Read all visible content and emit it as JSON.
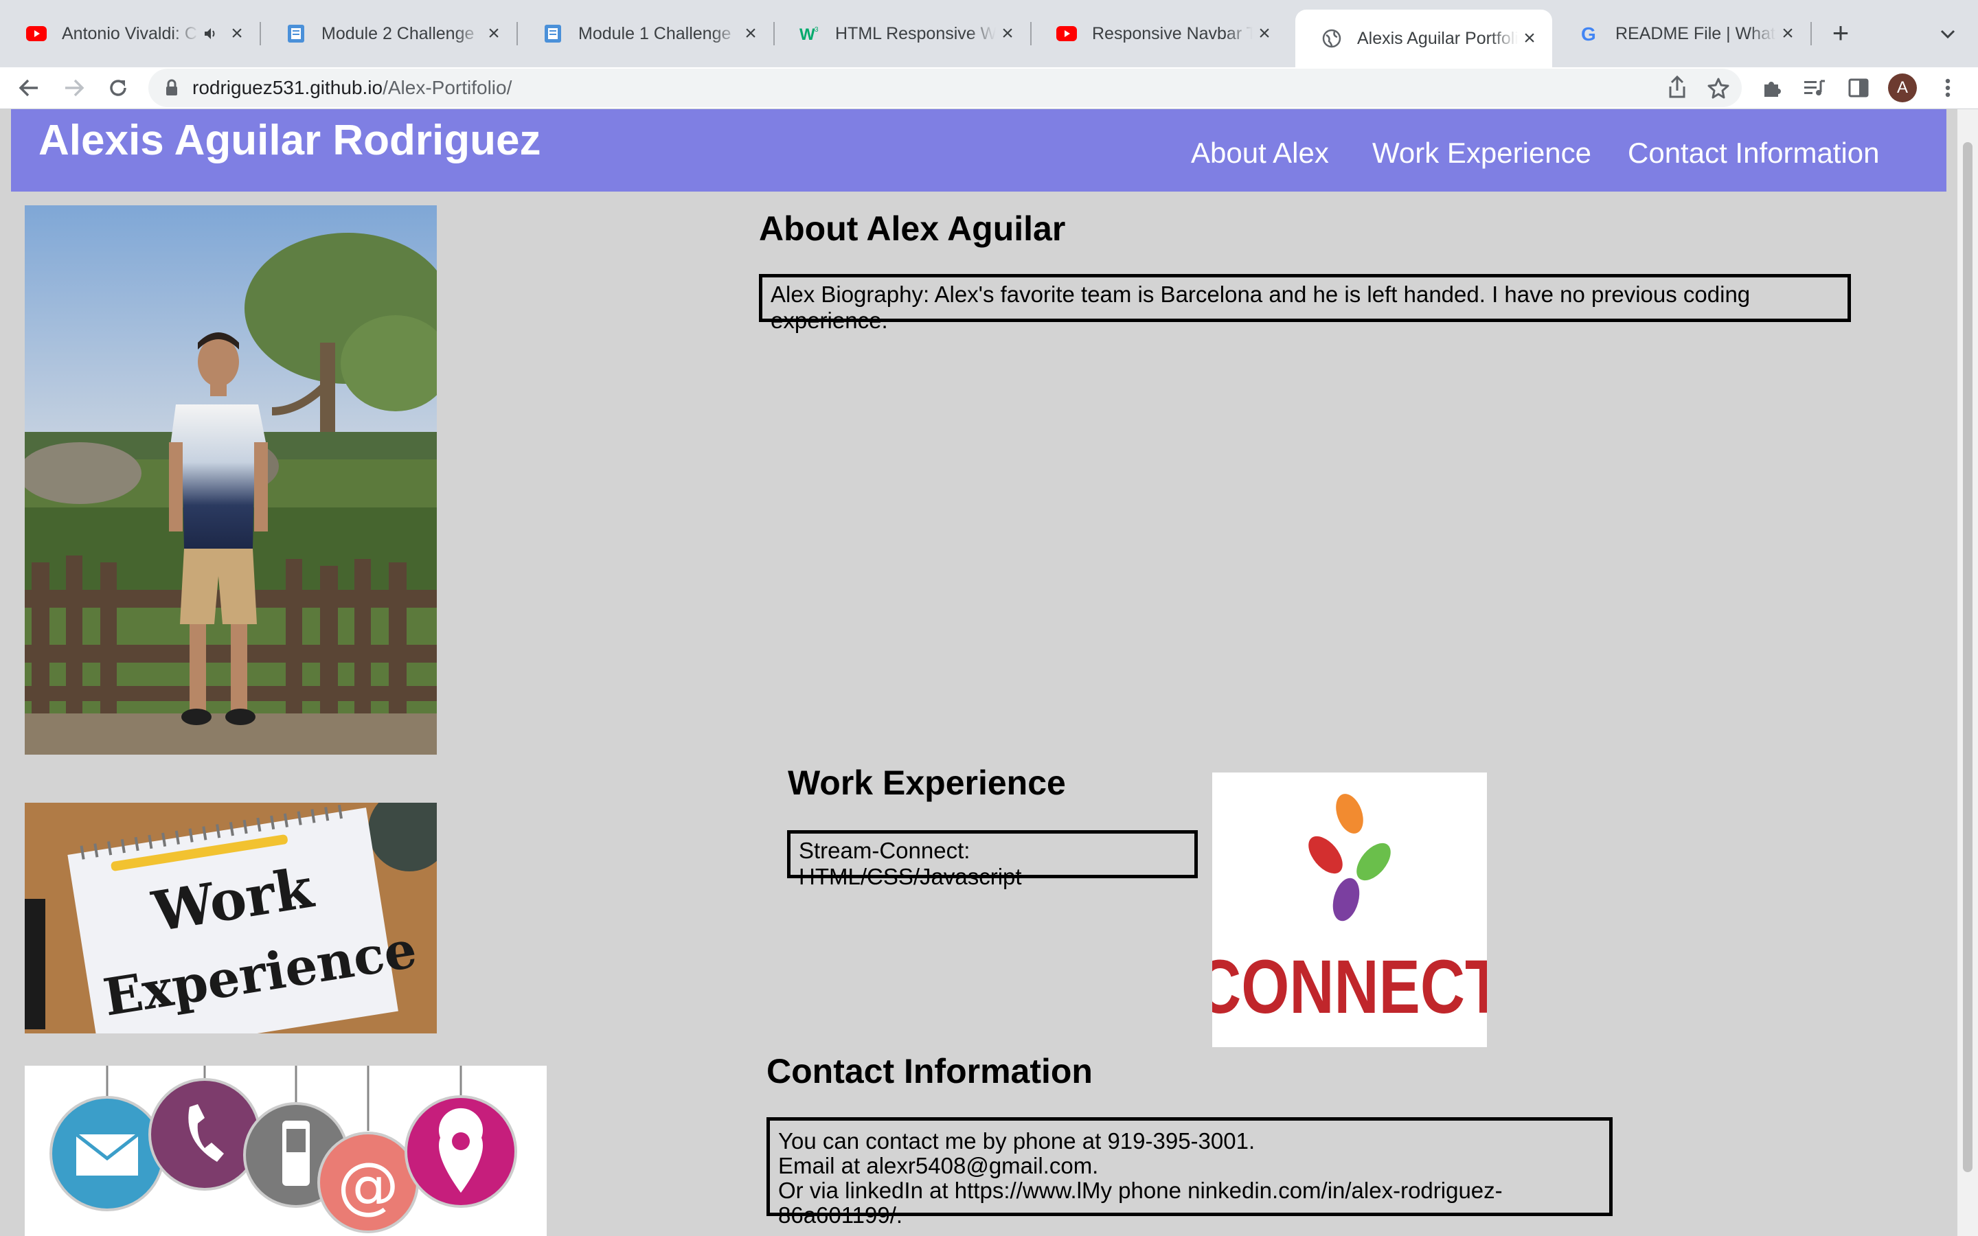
{
  "browser": {
    "tabs": [
      {
        "title": "Antonio Vivaldi: C",
        "favicon": "youtube-icon",
        "audio": true
      },
      {
        "title": "Module 2 Challenge",
        "favicon": "canvas-doc-icon"
      },
      {
        "title": "Module 1 Challenge",
        "favicon": "canvas-doc-icon"
      },
      {
        "title": "HTML Responsive We",
        "favicon": "w3schools-icon"
      },
      {
        "title": "Responsive Navbar Tu",
        "favicon": "youtube-icon"
      },
      {
        "title": "Alexis Aguilar Portfolio",
        "favicon": "globe-icon",
        "active": true
      },
      {
        "title": "README File | What is",
        "favicon": "google-icon"
      }
    ],
    "url_host": "rodriguez531.github.io",
    "url_path": "/Alex-Portifolio/",
    "profile_initial": "A"
  },
  "page": {
    "site_title": "Alexis Aguilar Rodriguez",
    "nav": [
      "About Alex",
      "Work Experience",
      "Contact Information"
    ],
    "about": {
      "heading": "About Alex Aguilar",
      "bio": "Alex Biography: Alex's favorite team is Barcelona and he is left handed. I have no previous coding experience."
    },
    "work": {
      "heading": "Work Experience",
      "item": "Stream-Connect: HTML/CSS/Javascript",
      "logo_text": "CONNECT",
      "image_text_1": "Work",
      "image_text_2": "Experience"
    },
    "contact": {
      "heading": "Contact Information",
      "line1": "You can contact me by phone at 919-395-3001.",
      "line2": "Email at alexr5408@gmail.com.",
      "line3": "Or via linkedIn at https://www.lMy phone ninkedin.com/in/alex-rodriguez-86a601199/."
    }
  },
  "colors": {
    "header_bg": "#7f7fe3",
    "page_bg": "#d3d3d3",
    "connect_red": "#c0262b"
  }
}
